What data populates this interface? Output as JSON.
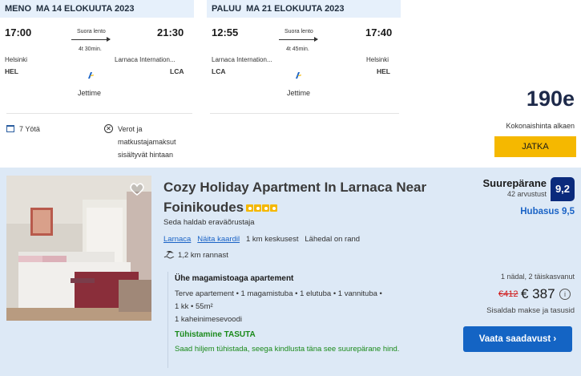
{
  "outbound": {
    "direction": "MENO",
    "date": "MA 14 ELOKUUTA 2023",
    "depart_time": "17:00",
    "arrive_time": "21:30",
    "direct_label": "Suora lento",
    "duration": "4t 30min.",
    "from_city": "Helsinki",
    "from_code": "HEL",
    "to_city": "Larnaca Internation...",
    "to_code": "LCA",
    "airline": "Jettime"
  },
  "return": {
    "direction": "PALUU",
    "date": "MA 21 ELOKUUTA 2023",
    "depart_time": "12:55",
    "arrive_time": "17:40",
    "direct_label": "Suora lento",
    "duration": "4t 45min.",
    "from_city": "Larnaca Internation...",
    "from_code": "LCA",
    "to_city": "Helsinki",
    "to_code": "HEL",
    "airline": "Jettime"
  },
  "trip_info": {
    "nights": "7 Yötä",
    "taxes_line1": "Verot ja",
    "taxes_line2": "matkustajamaksut",
    "taxes_line3": "sisältyvät hintaan"
  },
  "package": {
    "price": "190e",
    "total_label": "Kokonaishinta alkaen",
    "continue_label": "JATKA"
  },
  "hotel": {
    "title_line1": "Cozy Holiday Apartment In Larnaca Near",
    "title_line2": "Foinikoudes",
    "stars": 4,
    "managed_by": "Seda haldab eraväõrustaja",
    "location_link": "Larnaca",
    "map_link": "Näita kaardil",
    "center_distance": "1 km keskusest",
    "beach_near": "Lähedal on rand",
    "beach_distance": "1,2 km rannast",
    "room_type": "Ühe magamistoaga apartement",
    "room_desc_line1": "Terve apartement • 1 magamistuba • 1 elutuba • 1 vannituba •",
    "room_desc_line2": "1 kk • 55m²",
    "room_desc_line3": "1 kaheinimesevoodi",
    "free_cancel": "Tühistamine TASUTA",
    "free_desc": "Saad hiljem tühistada, seega kindlusta täna see suurepärane hind.",
    "score_word": "Suurepärane",
    "reviews": "42 arvustust",
    "score": "9,2",
    "location_score": "Hubasus 9,5",
    "stay_info": "1 nädal, 2 täiskasvanut",
    "old_price": "€412",
    "new_price": "€ 387",
    "includes": "Sisaldab makse ja tasusid",
    "availability_label": "Vaata saadavust  ›"
  },
  "colors": {
    "header_bg": "#e6f0fb",
    "hotel_bg": "#dde9f6",
    "continue_btn": "#f5b800",
    "availability_btn": "#1464c4",
    "score_badge": "#0a2a7c",
    "free_cancel": "#1a8a1a",
    "old_price": "#d01c1c"
  }
}
